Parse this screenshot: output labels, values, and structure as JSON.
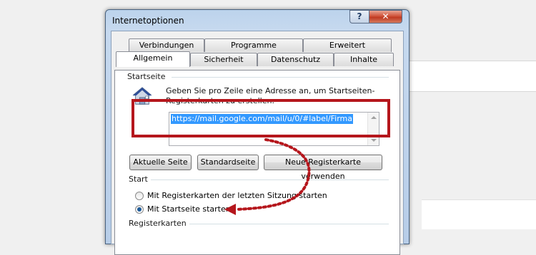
{
  "dialog": {
    "title": "Internetoptionen",
    "help_label": "?",
    "close_label": "✕"
  },
  "tabs": {
    "row1": [
      "Verbindungen",
      "Programme",
      "Erweitert"
    ],
    "row2": [
      "Allgemein",
      "Sicherheit",
      "Datenschutz",
      "Inhalte"
    ],
    "active": "Allgemein"
  },
  "startseite": {
    "heading": "Startseite",
    "description": "Geben Sie pro Zeile eine Adresse an, um Startseiten-Registerkarten zu erstellen.",
    "url": "https://mail.google.com/mail/u/0/#label/Firma",
    "buttons": {
      "current": "Aktuelle Seite",
      "standard": "Standardseite",
      "new_tab": "Neue Registerkarte verwenden"
    }
  },
  "start": {
    "heading": "Start",
    "options": [
      {
        "label": "Mit Registerkarten der letzten Sitzung starten",
        "checked": false
      },
      {
        "label": "Mit Startseite starten",
        "checked": true
      }
    ]
  },
  "registerkarten": {
    "heading": "Registerkarten"
  },
  "colors": {
    "highlight": "#b5161c",
    "selection": "#3399ff"
  }
}
